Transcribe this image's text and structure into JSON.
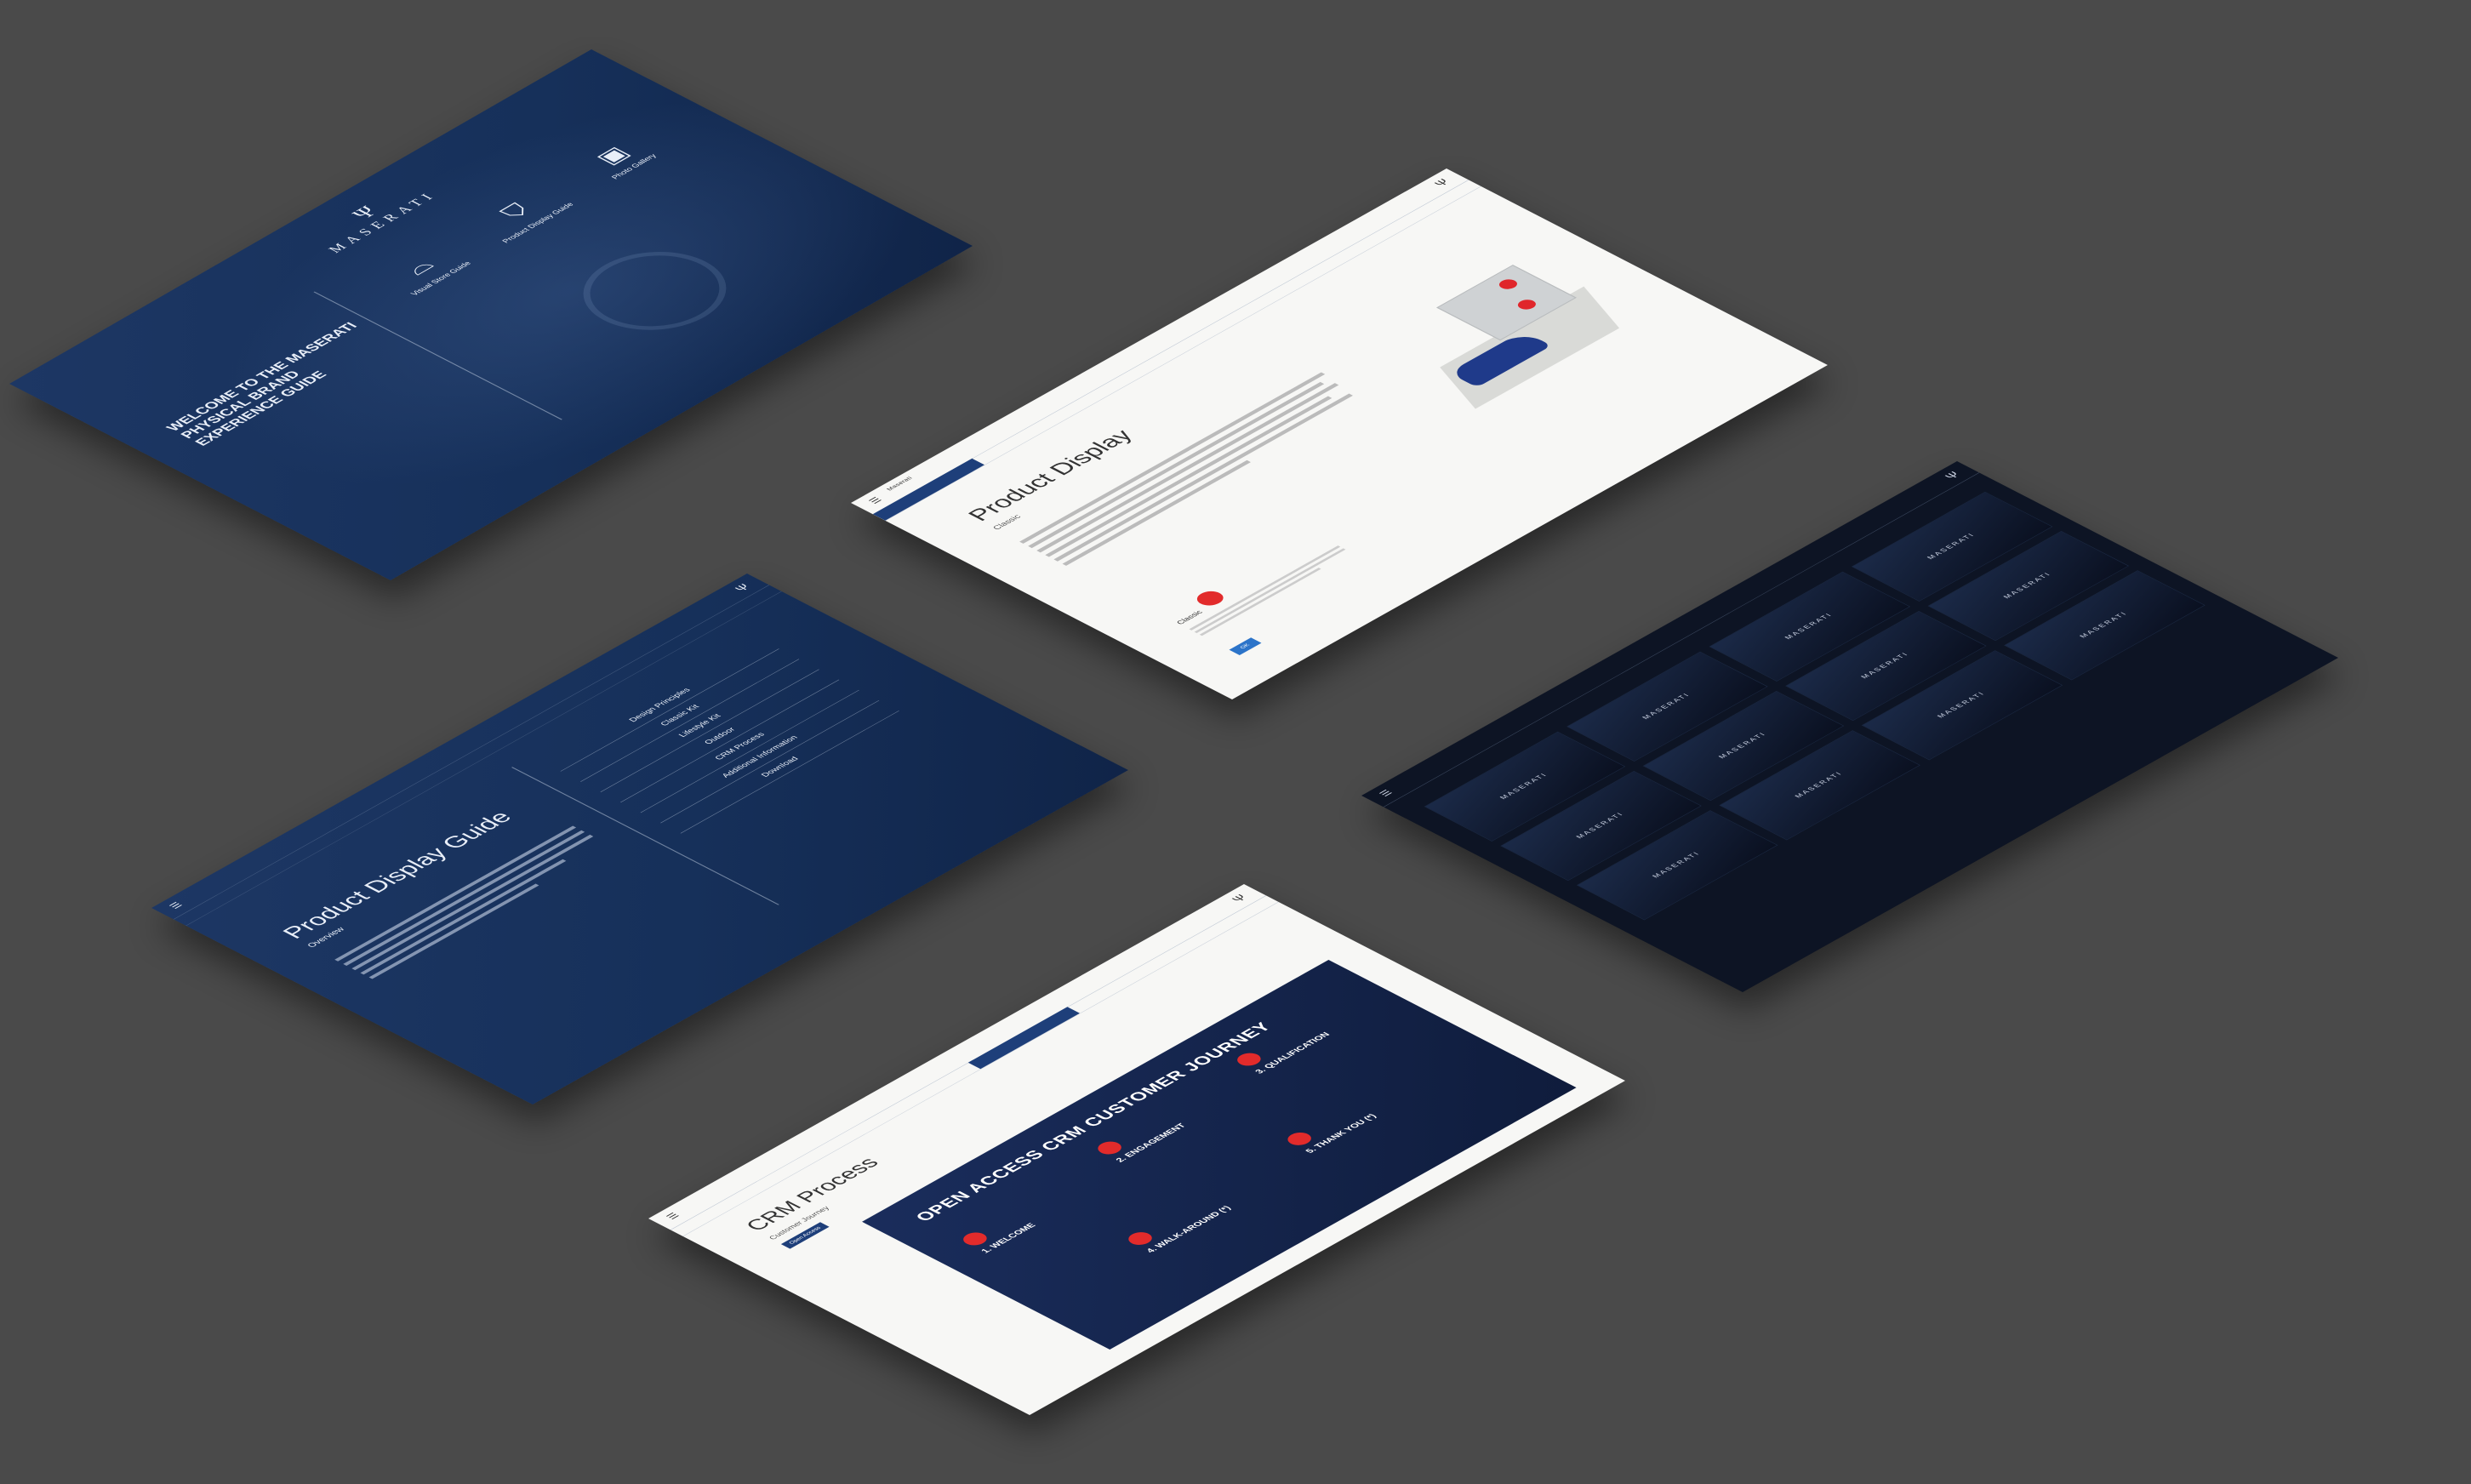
{
  "background": "#4a4a4a",
  "brand": {
    "logo_text": "MASERATI",
    "accent": "#e22b2b",
    "navy": "#1d3764"
  },
  "welcome": {
    "heading": "WELCOME TO THE MASERATI PHYSICAL BRAND EXPERIENCE GUIDE",
    "tiles": [
      {
        "label": "Visual Store Guide",
        "icon": "car-icon"
      },
      {
        "label": "Product Display Guide",
        "icon": "trident-badge-icon"
      },
      {
        "label": "Photo Gallery",
        "icon": "photo-icon"
      }
    ]
  },
  "product_display": {
    "header_app": "Maserati",
    "title": "Product Display",
    "kicker": "Classic",
    "classic_label": "Classic",
    "button": "OK"
  },
  "guide": {
    "title": "Product Display Guide",
    "kicker": "Overview",
    "menu": [
      "Design Principles",
      "Classic Kit",
      "Lifestyle Kit",
      "Outdoor",
      "CRM Process",
      "Additional Information",
      "Download"
    ]
  },
  "gallery": {
    "captions": [
      "MASERATI",
      "MASERATI",
      "MASERATI",
      "MASERATI",
      "MASERATI",
      "MASERATI",
      "MASERATI",
      "MASERATI",
      "MASERATI",
      "MASERATI",
      "MASERATI",
      "MASERATI"
    ]
  },
  "crm": {
    "title": "CRM Process",
    "kicker": "Customer Journey",
    "tag": "Open Access",
    "poster_heading": "OPEN ACCESS CRM CUSTOMER JOURNEY",
    "steps": [
      {
        "label": "1. WELCOME"
      },
      {
        "label": "2. ENGAGEMENT"
      },
      {
        "label": "3. QUALIFICATION"
      },
      {
        "label": "4. WALK-AROUND (*)"
      },
      {
        "label": "5. THANK YOU (*)"
      }
    ]
  }
}
